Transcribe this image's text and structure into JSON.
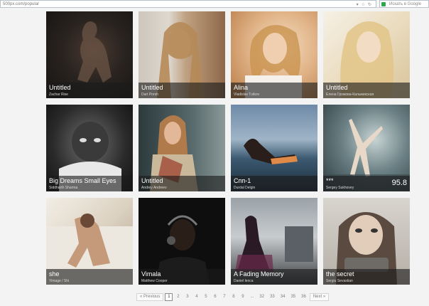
{
  "browser": {
    "url": "500px.com/popular",
    "search_placeholder": "Искать в Google"
  },
  "photos": [
    {
      "title": "Untitled",
      "author": "Zachar Rise",
      "score": ""
    },
    {
      "title": "Untitled",
      "author": "Dart Porsh",
      "score": ""
    },
    {
      "title": "Alina",
      "author": "Vladislav Tutkov",
      "score": ""
    },
    {
      "title": "Untitled",
      "author": "Елена Громова-Кальмикская",
      "score": ""
    },
    {
      "title": "Big Dreams Small Eyes",
      "author": "Siddharth Sharma",
      "score": ""
    },
    {
      "title": "Untitled",
      "author": "Andrey Andreev",
      "score": ""
    },
    {
      "title": "Спп-1",
      "author": "Durdal Delgin",
      "score": ""
    },
    {
      "title": "***",
      "author": "Sergey Sukhovey",
      "score": "95.8"
    },
    {
      "title": "she",
      "author": "Yimage / Shi",
      "score": ""
    },
    {
      "title": "Vimala",
      "author": "Matthew Cooper",
      "score": ""
    },
    {
      "title": "A Fading Memory",
      "author": "Daniel lenca",
      "score": ""
    },
    {
      "title": "the secret",
      "author": "Sergiu Sevastian",
      "score": ""
    }
  ],
  "pagination": {
    "previous": "« Previous",
    "pages": [
      "1",
      "2",
      "3",
      "4",
      "5",
      "6",
      "7",
      "8",
      "9",
      "...",
      "32",
      "33",
      "34",
      "35",
      "36"
    ],
    "current": "1",
    "next": "Next »"
  }
}
